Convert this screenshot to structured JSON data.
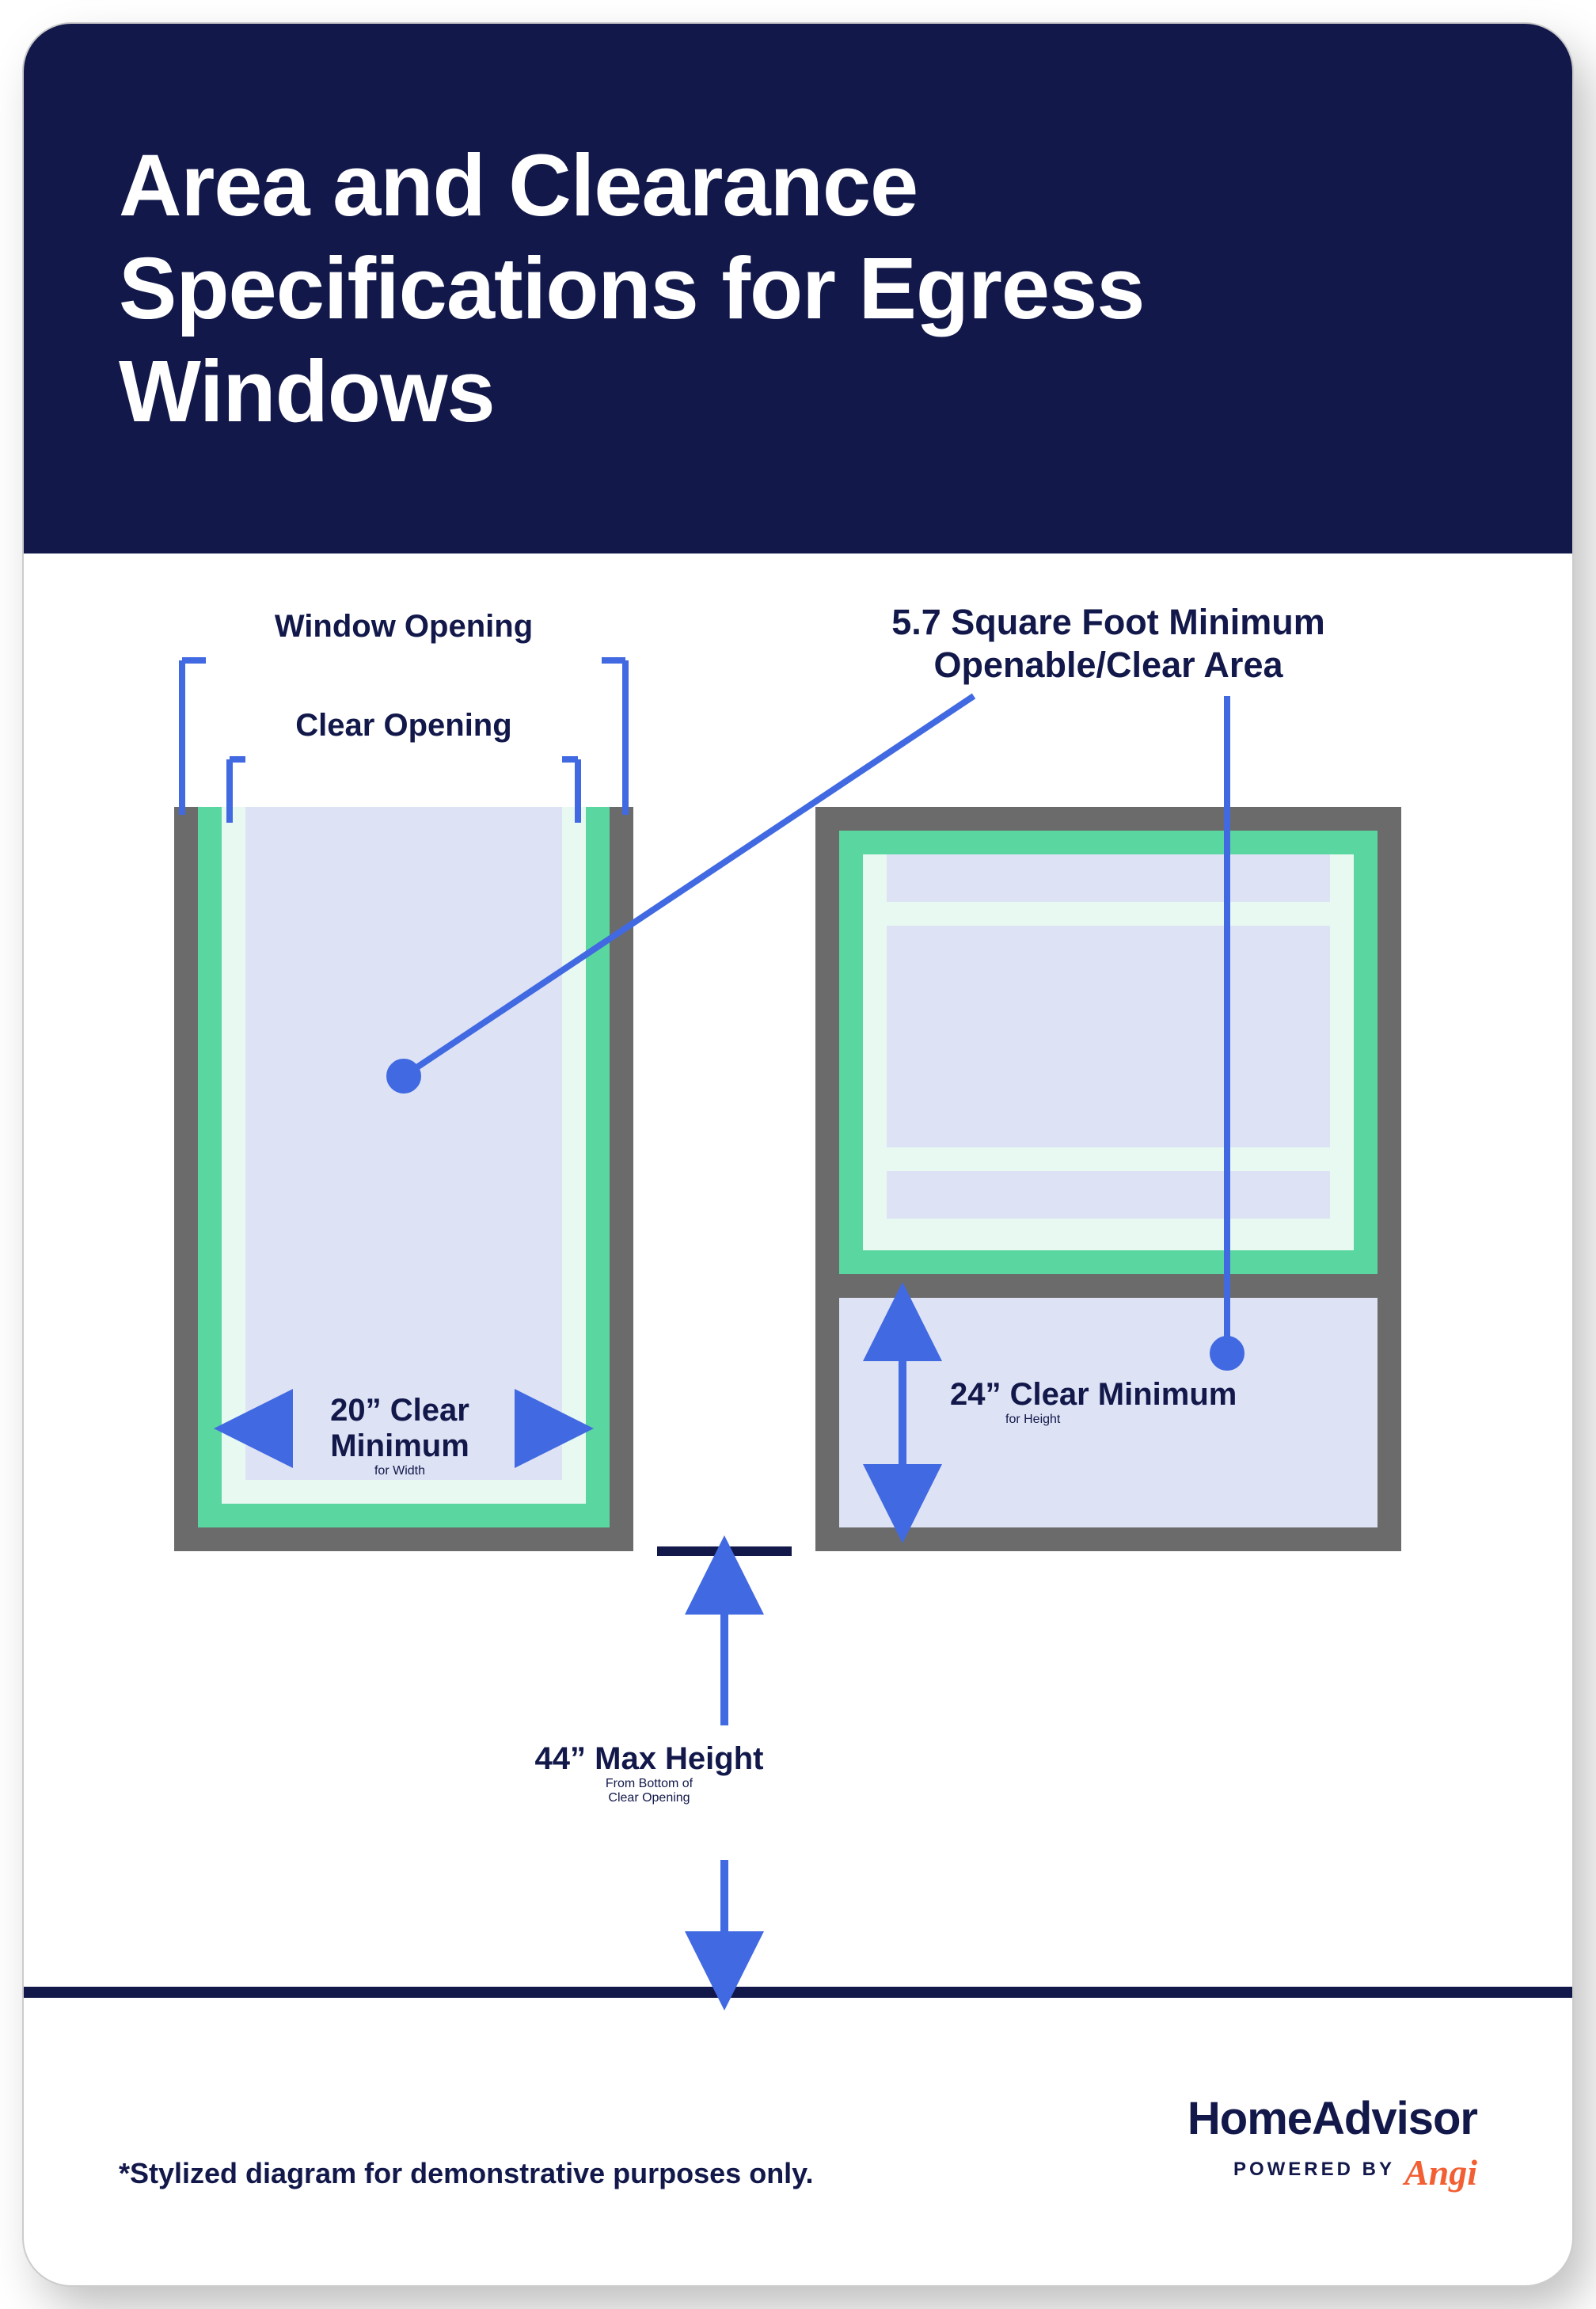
{
  "title": "Area and Clearance Specifications for Egress Windows",
  "labels": {
    "window_opening": "Window Opening",
    "clear_opening": "Clear Opening",
    "sqft_line1": "5.7 Square Foot Minimum",
    "sqft_line2": "Openable/Clear Area",
    "width_min_bold": "20” Clear Minimum",
    "width_min_sub": "for Width",
    "height_min_bold": "24” Clear Minimum",
    "height_min_sub": "for Height",
    "max_height_bold": "44” Max Height",
    "max_height_sub1": "From Bottom of",
    "max_height_sub2": "Clear Opening"
  },
  "specs": {
    "min_clear_area_sqft": 5.7,
    "min_clear_width_in": 20,
    "min_clear_height_in": 24,
    "max_sill_height_in": 44
  },
  "footer": {
    "disclaimer": "*Stylized diagram for demonstrative purposes only.",
    "brand": "HomeAdvisor",
    "powered_by": "POWERED BY",
    "angi": "Angi"
  }
}
